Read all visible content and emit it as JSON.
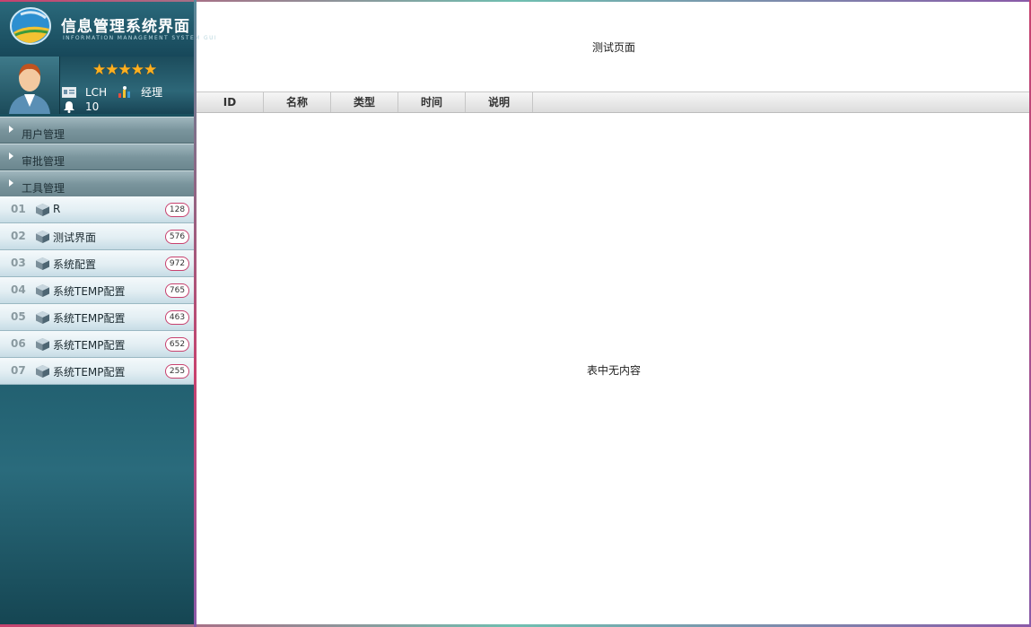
{
  "app": {
    "title": "信息管理系统界面",
    "subtitle": "INFORMATION MANAGEMENT SYSTEM GUI"
  },
  "user": {
    "rating": "★★★★★",
    "name": "LCH",
    "role": "经理",
    "notifications": "10"
  },
  "menu_groups": [
    {
      "label": "用户管理"
    },
    {
      "label": "审批管理"
    },
    {
      "label": "工具管理"
    }
  ],
  "tools": [
    {
      "num": "01",
      "label": "R",
      "count": "128"
    },
    {
      "num": "02",
      "label": "测试界面",
      "count": "576"
    },
    {
      "num": "03",
      "label": "系统配置",
      "count": "972"
    },
    {
      "num": "04",
      "label": "系统TEMP配置",
      "count": "765"
    },
    {
      "num": "05",
      "label": "系统TEMP配置",
      "count": "463"
    },
    {
      "num": "06",
      "label": "系统TEMP配置",
      "count": "652"
    },
    {
      "num": "07",
      "label": "系统TEMP配置",
      "count": "255"
    }
  ],
  "main": {
    "page_title": "测试页面",
    "columns": [
      "ID",
      "名称",
      "类型",
      "时间",
      "说明"
    ],
    "empty_text": "表中无内容"
  },
  "colors": {
    "sidebar": "#16505f",
    "accent": "#c8416e",
    "star": "#ffb020"
  }
}
